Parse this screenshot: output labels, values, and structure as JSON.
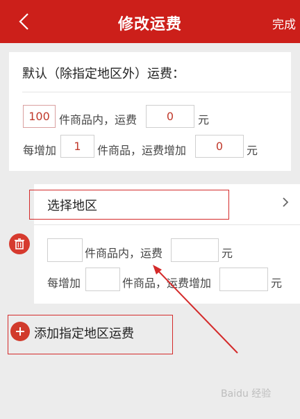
{
  "header": {
    "back_icon": "chevron-left-icon",
    "title": "修改运费",
    "done_label": "完成"
  },
  "default_section": {
    "heading": "默认（除指定地区外）运费：",
    "first_count_value": "100",
    "first_count_suffix": "件商品内，运费",
    "first_fee_value": "0",
    "yuan": "元",
    "each_add_prefix": "每增加",
    "add_count_value": "1",
    "add_count_suffix": "件商品，运费增加",
    "add_fee_value": "0"
  },
  "region_section": {
    "select_label": "选择地区",
    "chevron_icon": "chevron-right-icon",
    "delete_icon": "trash-icon",
    "first_count_value": "",
    "first_count_suffix": "件商品内，运费",
    "first_fee_value": "",
    "yuan": "元",
    "each_add_prefix": "每增加",
    "add_count_value": "",
    "add_count_suffix": "件商品，运费增加",
    "add_fee_value": ""
  },
  "add_region": {
    "icon": "plus-icon",
    "label": "添加指定地区运费"
  },
  "watermark": {
    "text": "Baidu 经验"
  },
  "colors": {
    "header_bg": "#cc1f1a",
    "accent_red": "#d13b2c",
    "annotation_red": "#d42a2a",
    "page_bg": "#ececec"
  }
}
